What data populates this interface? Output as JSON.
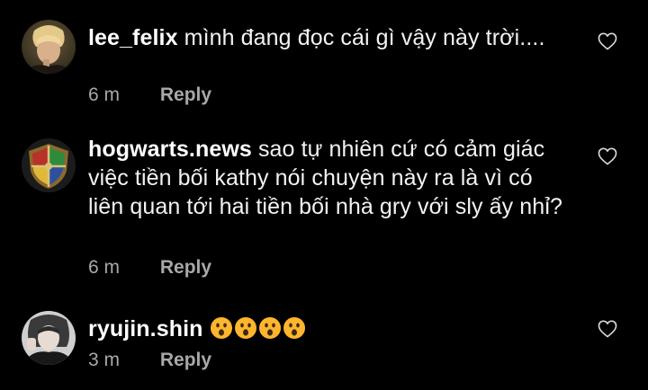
{
  "comments": [
    {
      "username": "lee_felix",
      "text": "mình đang đọc cái gì vậy này trời....",
      "time": "6 m",
      "reply_label": "Reply",
      "avatar_icon": "user-avatar-photo",
      "like_icon": "heart-outline-icon"
    },
    {
      "username": "hogwarts.news",
      "text": "sao tự nhiên cứ có cảm giác việc tiền bối kathy nói chuyện này ra là vì có liên quan tới hai tiền bối nhà gry với sly ấy nhỉ?",
      "time": "6 m",
      "reply_label": "Reply",
      "avatar_icon": "hogwarts-crest-avatar",
      "like_icon": "heart-outline-icon"
    },
    {
      "username": "ryujin.shin",
      "text": "",
      "emoji_count": 4,
      "emoji_icon": "hushed-face-emoji",
      "time": "3 m",
      "reply_label": "Reply",
      "avatar_icon": "user-avatar-photo",
      "like_icon": "heart-outline-icon"
    }
  ],
  "colors": {
    "background": "#000000",
    "text": "#f2f2f2",
    "meta": "#a8a8a8",
    "emoji_face": "#ffb52e"
  }
}
